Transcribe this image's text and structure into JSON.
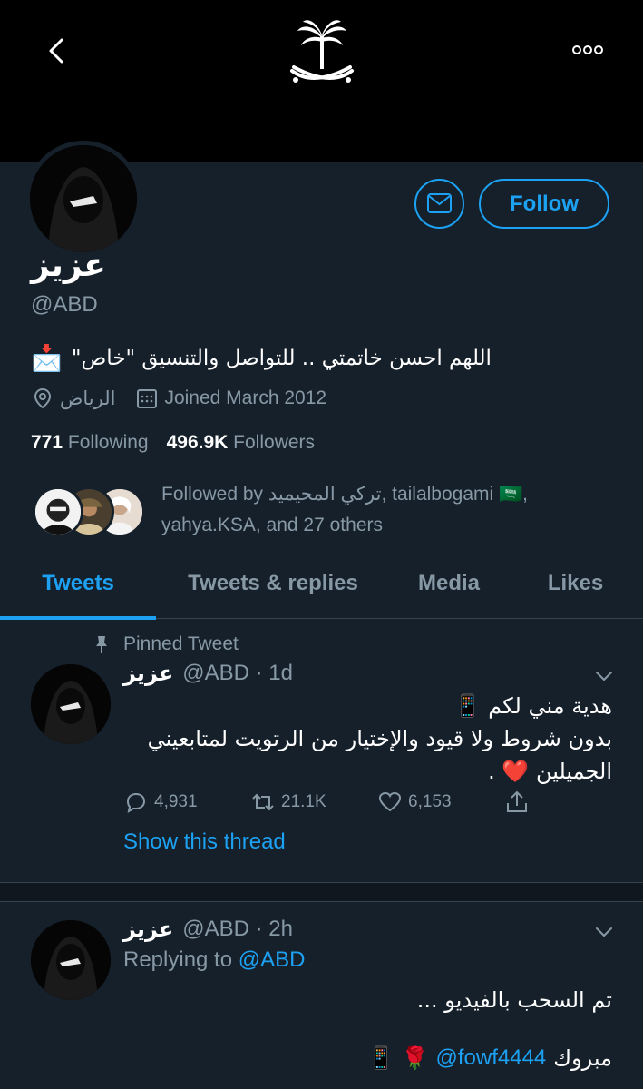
{
  "profile": {
    "name": "عزيز",
    "handle": "@ABD",
    "bio": "اللهم احسن خاتمتي .. للتواصل والتنسيق \"خاص\"",
    "bio_icon": "📩",
    "location": "الرياض",
    "joined": "Joined March 2012",
    "following_count": "771",
    "following_label": "Following",
    "followers_count": "496.9K",
    "followers_label": "Followers",
    "followed_by_line1": "Followed by تركي المحيميد, tailalbogami 🇸🇦,",
    "followed_by_line2": "yahya.KSA, and 27 others"
  },
  "header": {
    "back_icon": "chevron-left-icon",
    "more_icon": "more-icon",
    "emblem_icon": "saudi-emblem-icon"
  },
  "actions": {
    "follow_label": "Follow",
    "message_icon": "envelope-icon"
  },
  "tabs": [
    {
      "label": "Tweets",
      "active": true
    },
    {
      "label": "Tweets & replies",
      "active": false
    },
    {
      "label": "Media",
      "active": false
    },
    {
      "label": "Likes",
      "active": false
    }
  ],
  "tweets": [
    {
      "pinned_label": "Pinned Tweet",
      "name": "عزيز",
      "meta": "@ABD · 1d",
      "line1": "هدية مني لكم 📱",
      "line2": "بدون شروط ولا قيود والإختيار من الرتويت لمتابعيني",
      "line3": "الجميلين ❤️ .",
      "replies": "4,931",
      "retweets": "21.1K",
      "likes": "6,153",
      "show_thread": "Show this thread"
    },
    {
      "name": "عزيز",
      "meta": "@ABD · 2h",
      "replying_prefix": "Replying to",
      "replying_to": "@ABD",
      "line1": "تم السحب بالفيديو ...",
      "line2_text": "مبروك",
      "line2_mention": "@fowf4444",
      "line2_emoji": "📱 🌹"
    }
  ],
  "colors": {
    "background": "#15202b",
    "accent": "#1da1f2",
    "secondary_text": "#8899a6",
    "divider": "#38444d"
  }
}
